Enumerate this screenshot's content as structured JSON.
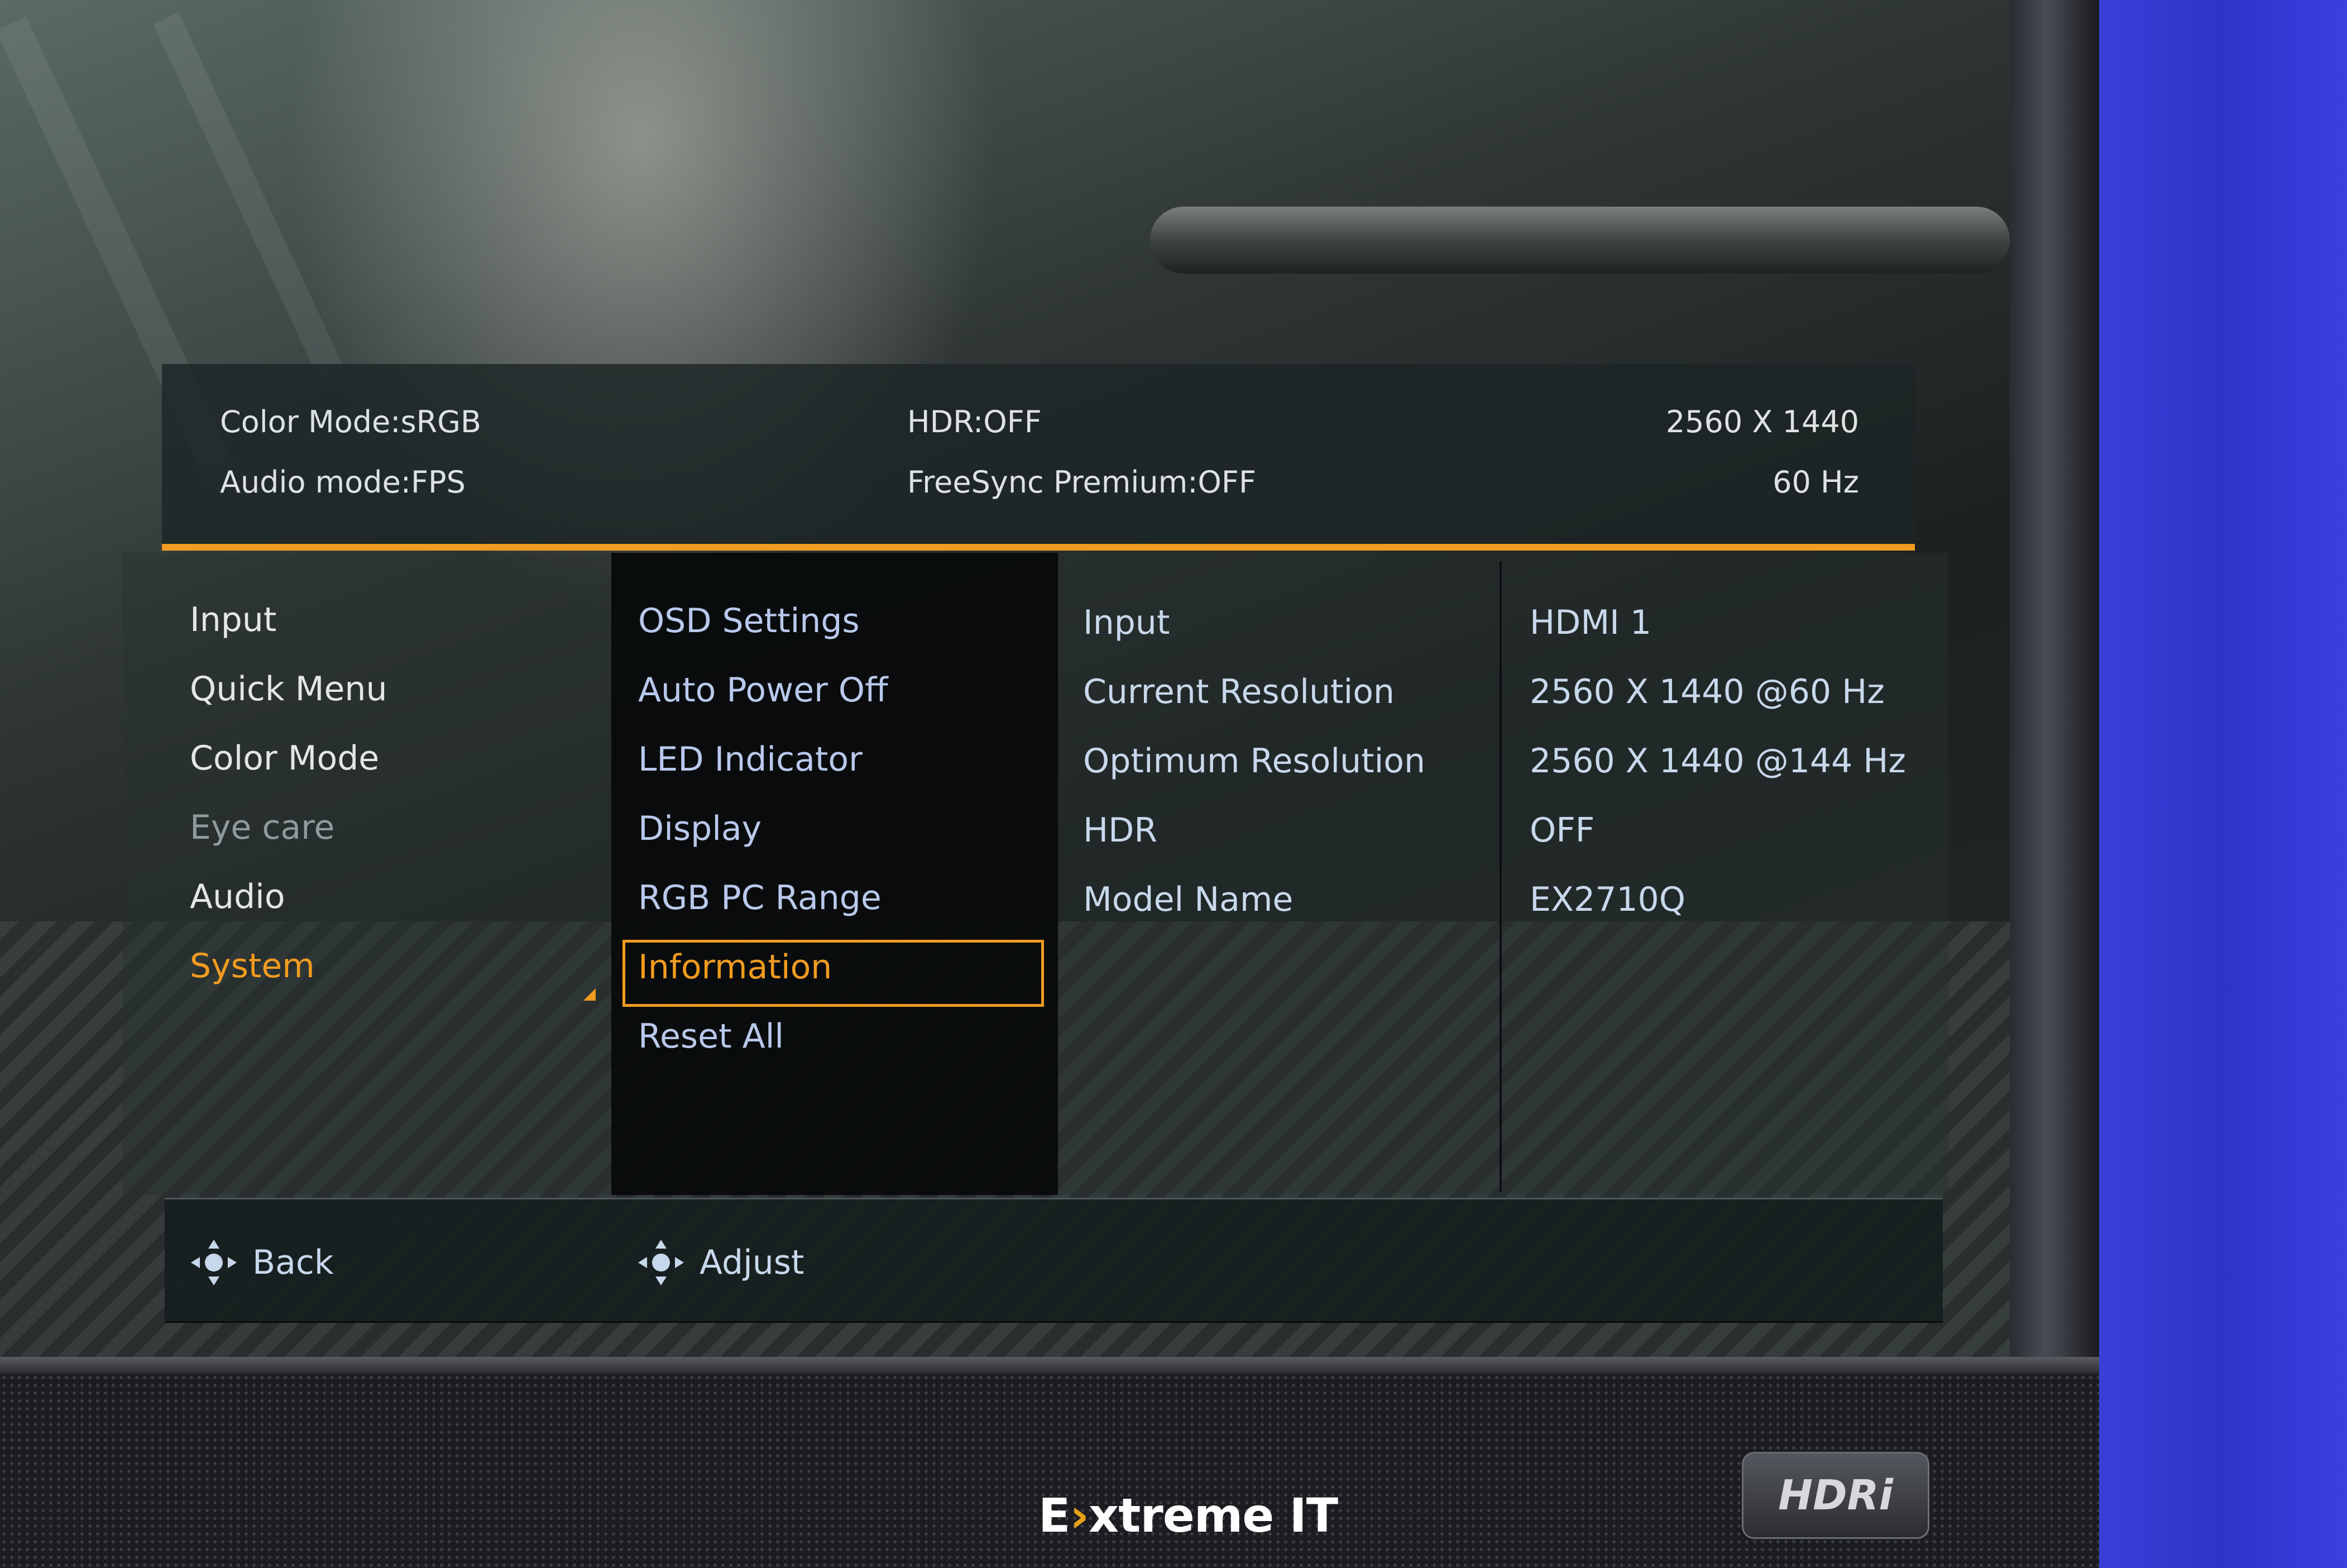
{
  "osd": {
    "status": {
      "color_mode": "Color Mode:sRGB",
      "audio_mode": "Audio mode:FPS",
      "hdr": "HDR:OFF",
      "freesync": "FreeSync Premium:OFF",
      "resolution": "2560 X 1440",
      "refresh": "60 Hz"
    },
    "main_menu": [
      {
        "label": "Input"
      },
      {
        "label": "Quick Menu"
      },
      {
        "label": "Color Mode"
      },
      {
        "label": "Eye care"
      },
      {
        "label": "Audio"
      },
      {
        "label": "System"
      }
    ],
    "sub_menu": [
      {
        "label": "OSD Settings"
      },
      {
        "label": "Auto Power Off"
      },
      {
        "label": "LED Indicator"
      },
      {
        "label": "Display"
      },
      {
        "label": "RGB PC Range"
      },
      {
        "label": "Information"
      },
      {
        "label": "Reset All"
      }
    ],
    "info": [
      {
        "label": "Input",
        "value": "HDMI 1"
      },
      {
        "label": "Current Resolution",
        "value": "2560 X 1440 @60 Hz"
      },
      {
        "label": "Optimum Resolution",
        "value": "2560 X 1440 @144 Hz"
      },
      {
        "label": "HDR",
        "value": "OFF"
      },
      {
        "label": "Model Name",
        "value": "EX2710Q"
      }
    ],
    "footer": {
      "back_label": "Back",
      "adjust_label": "Adjust"
    },
    "accent_color": "#f29c1f"
  },
  "bezel": {
    "badge": "HDRi",
    "watermark_prefix": "E",
    "watermark_accent": "›",
    "watermark_rest": "xtreme IT"
  }
}
